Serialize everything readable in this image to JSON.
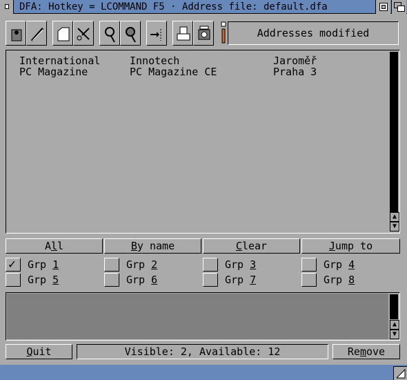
{
  "window": {
    "title": "DFA: Hotkey = LCOMMAND F5 · Address file: default.dfa"
  },
  "toolbar": {
    "icons": [
      "paste-icon",
      "pen-icon",
      "folder-icon",
      "scissors-icon",
      "search-icon",
      "search-next-icon",
      "export-icon",
      "print-icon",
      "dial-icon"
    ],
    "status": "Addresses modified"
  },
  "addresses": {
    "rows": [
      {
        "name": "International",
        "company": "Innotech",
        "city": "Jaroměř"
      },
      {
        "name": "PC Magazine",
        "company": "PC Magazine CE",
        "city": "Praha 3"
      }
    ]
  },
  "buttons": {
    "all": {
      "pre": "A",
      "key": "l",
      "post": "l"
    },
    "by_name": {
      "pre": "",
      "key": "B",
      "post": "y name"
    },
    "clear": {
      "pre": "",
      "key": "C",
      "post": "lear"
    },
    "jump_to": {
      "pre": "",
      "key": "J",
      "post": "ump to"
    }
  },
  "groups": [
    {
      "label": "Grp ",
      "num": "1",
      "checked": true
    },
    {
      "label": "Grp ",
      "num": "2",
      "checked": false
    },
    {
      "label": "Grp ",
      "num": "3",
      "checked": false
    },
    {
      "label": "Grp ",
      "num": "4",
      "checked": false
    },
    {
      "label": "Grp ",
      "num": "5",
      "checked": false
    },
    {
      "label": "Grp ",
      "num": "6",
      "checked": false
    },
    {
      "label": "Grp ",
      "num": "7",
      "checked": false
    },
    {
      "label": "Grp ",
      "num": "8",
      "checked": false
    }
  ],
  "footer": {
    "quit": {
      "pre": "",
      "key": "Q",
      "post": "uit"
    },
    "summary": "Visible: 2, Available: 12",
    "remove": {
      "pre": "Re",
      "key": "m",
      "post": "ove"
    }
  },
  "scroll": {
    "up": "▲",
    "down": "▼"
  },
  "check_mark": "✓",
  "colors": {
    "titlebar": "#6688bb",
    "background": "#aaaaaa"
  }
}
